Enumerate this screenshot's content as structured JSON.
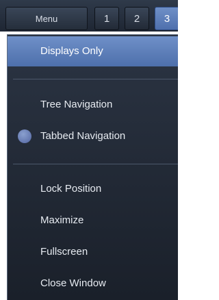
{
  "topbar": {
    "menu_label": "Menu",
    "tabs": [
      {
        "label": "1",
        "active": false
      },
      {
        "label": "2",
        "active": false
      },
      {
        "label": "3",
        "active": true
      }
    ]
  },
  "menu": {
    "items": [
      {
        "label": "Displays Only",
        "highlighted": true
      },
      {
        "label": "Tree Navigation"
      },
      {
        "label": "Tabbed Navigation",
        "selected": true
      },
      {
        "label": "Lock Position"
      },
      {
        "label": "Maximize"
      },
      {
        "label": "Fullscreen"
      },
      {
        "label": "Close Window"
      }
    ]
  },
  "colors": {
    "highlight": "#5f80bb",
    "panel_bg": "#222a36",
    "text": "#e7ebf1"
  }
}
